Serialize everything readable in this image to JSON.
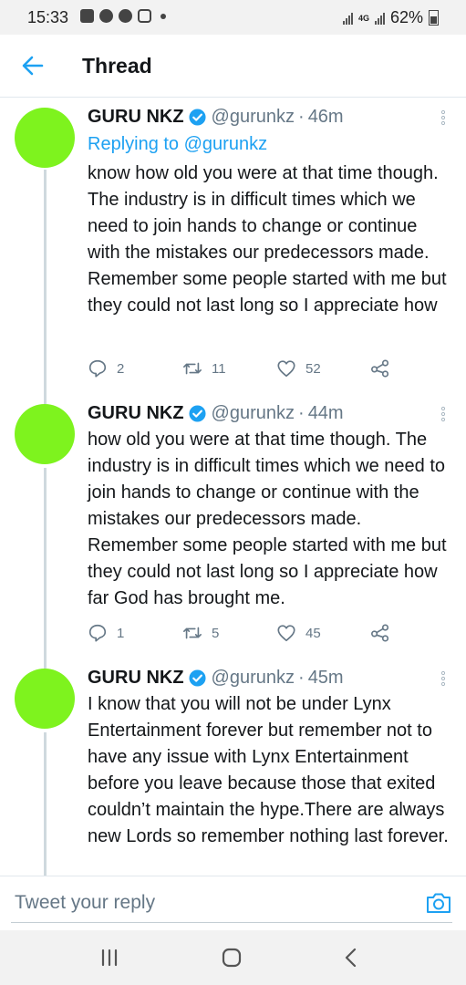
{
  "status_bar": {
    "time": "15:33",
    "network_label": "4G",
    "battery": "62%"
  },
  "header": {
    "title": "Thread"
  },
  "tweets": [
    {
      "name": "GURU NKZ",
      "handle": "@gurunkz",
      "separator": "·",
      "time": "46m",
      "replying_prefix": "Replying to",
      "replying_to": "@gurunkz",
      "text": "know how old you were at that time though. The industry is in difficult times which we need to join hands to change or continue with the mistakes our predecessors made. Remember some people started with me but they could not last long so I appreciate how",
      "replies": "2",
      "retweets": "11",
      "likes": "52"
    },
    {
      "name": "GURU NKZ",
      "handle": "@gurunkz",
      "separator": "·",
      "time": "44m",
      "text": "how old you were at that time though. The industry is in difficult times which we need to join hands to change or continue with the mistakes our predecessors made. Remember some people started with me but they could not last long so I appreciate how far God has brought me.",
      "replies": "1",
      "retweets": "5",
      "likes": "45"
    },
    {
      "name": "GURU NKZ",
      "handle": "@gurunkz",
      "separator": "·",
      "time": "45m",
      "text": "I know that you will not be under Lynx Entertainment forever but remember not to have any issue with Lynx Entertainment before you leave because those that exited couldn’t maintain the hype.There are always new Lords so remember nothing last forever."
    }
  ],
  "reply_bar": {
    "placeholder": "Tweet your reply"
  },
  "colors": {
    "accent": "#1da1f2",
    "avatar": "#7ef31e",
    "muted": "#657786"
  }
}
